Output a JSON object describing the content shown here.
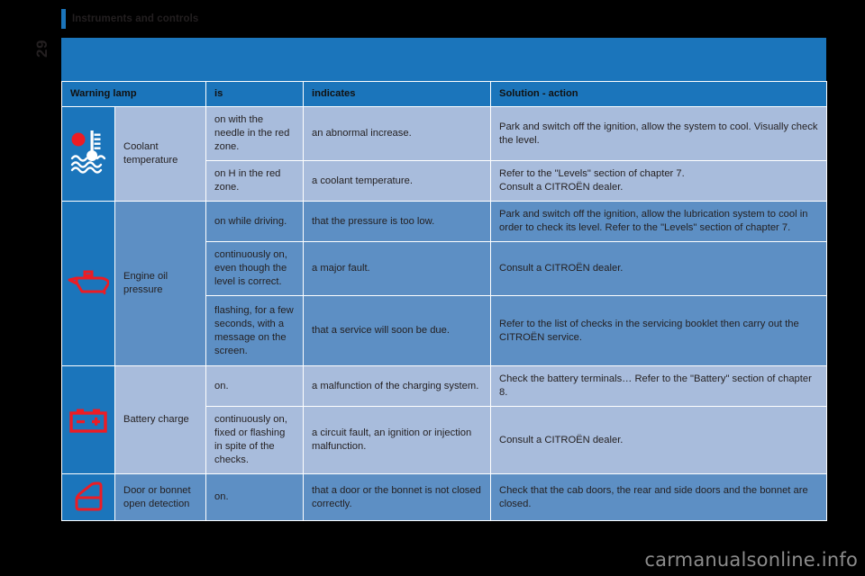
{
  "header": {
    "chapter_title": "Instruments and controls",
    "page_number": "29",
    "accent_color": "#1b75bb"
  },
  "watermark": "carmanualsonline.info",
  "table": {
    "columns": [
      "Warning lamp",
      "is",
      "indicates",
      "Solution - action"
    ],
    "col_headers": {
      "warning_lamp": "Warning lamp",
      "is": "is",
      "indicates": "indicates",
      "solution": "Solution - action"
    },
    "groups": [
      {
        "icon": "coolant-temperature-icon",
        "name": "Coolant\ntemperature",
        "name_line1": "Coolant",
        "name_line2": "temperature",
        "shade": "light",
        "rows": [
          {
            "is": "on with the needle in the red zone.",
            "indicates": "an abnormal increase.",
            "solution": "Park and switch off the ignition, allow the system to cool. Visually check the level."
          },
          {
            "is": "on H in the red zone.",
            "indicates": "a coolant temperature.",
            "solution": "Refer to the \"Levels\" section of chapter 7.\nConsult a CITROËN dealer."
          }
        ]
      },
      {
        "icon": "engine-oil-pressure-icon",
        "name": "Engine oil\npressure",
        "name_line1": "Engine oil",
        "name_line2": "pressure",
        "shade": "dark",
        "rows": [
          {
            "is": "on while driving.",
            "indicates": "that the pressure is too low.",
            "solution": "Park and switch off the ignition, allow the lubrication system to cool in order to check its level. Refer to the \"Levels\" section of chapter 7."
          },
          {
            "is": "continuously on, even though the level is correct.",
            "indicates": "a major fault.",
            "solution": "Consult a CITROËN dealer."
          },
          {
            "is": "flashing, for a few seconds, with a message on the screen.",
            "indicates": " that a service will soon be due.",
            "solution": "Refer to the list of checks in the servicing booklet then carry out the CITROËN service."
          }
        ]
      },
      {
        "icon": "battery-charge-icon",
        "name": "Battery charge",
        "name_line1": "Battery charge",
        "name_line2": "",
        "shade": "light",
        "rows": [
          {
            "is": "on.",
            "indicates": "a malfunction of the charging system.",
            "solution": "Check the battery terminals… Refer to the \"Battery\" section of chapter 8."
          },
          {
            "is": "continuously on, fixed or flashing in spite of the checks.",
            "indicates": "a circuit fault, an ignition or injection malfunction.",
            "solution": "Consult a CITROËN dealer."
          }
        ]
      },
      {
        "icon": "door-bonnet-open-icon",
        "name": "Door or bonnet\nopen detection",
        "name_line1": "Door or bonnet",
        "name_line2": "open detection",
        "shade": "dark",
        "rows": [
          {
            "is": "on.",
            "indicates": "that a door or the bonnet is not closed correctly.",
            "solution": "Check that the cab doors, the rear and side doors and the bonnet are closed."
          }
        ]
      }
    ]
  },
  "colors": {
    "brand_blue": "#1b75bb",
    "row_light": "#a8bcdc",
    "row_dark": "#5d8fc4",
    "icon_red": "#ed1c24",
    "page_bg": "#000000"
  }
}
